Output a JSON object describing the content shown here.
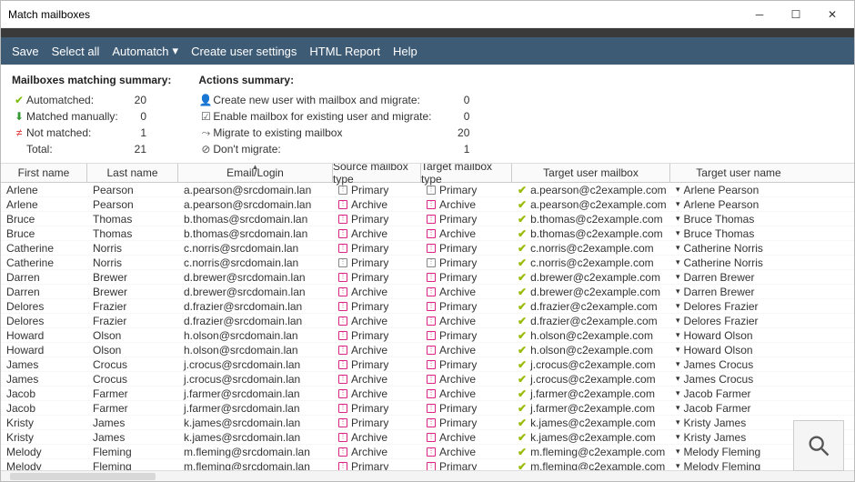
{
  "title": "Match mailboxes",
  "menubar": [
    "Save",
    "Select all",
    "Automatch",
    "Create user settings",
    "HTML Report",
    "Help"
  ],
  "summary": {
    "heading": "Mailboxes matching summary:",
    "rows": [
      {
        "icon": "check-green",
        "label": "Automatched:",
        "value": "20"
      },
      {
        "icon": "arrow-down-green",
        "label": "Matched manually:",
        "value": "0"
      },
      {
        "icon": "not-equal-red",
        "label": "Not matched:",
        "value": "1"
      },
      {
        "icon": "",
        "label": "Total:",
        "value": "21"
      }
    ]
  },
  "actions": {
    "heading": "Actions summary:",
    "rows": [
      {
        "icon": "user-plus",
        "label": "Create new user with mailbox and migrate:",
        "value": "0"
      },
      {
        "icon": "mailbox-check",
        "label": "Enable mailbox for existing user and migrate:",
        "value": "0"
      },
      {
        "icon": "arrow-right",
        "label": "Migrate to existing mailbox",
        "value": "20"
      },
      {
        "icon": "no-entry",
        "label": "Don't migrate:",
        "value": "1"
      }
    ]
  },
  "columns": [
    "First name",
    "Last name",
    "Email/Login",
    "Source mailbox type",
    "Target mailbox type",
    "Target user mailbox",
    "Target user name"
  ],
  "rows": [
    {
      "fn": "Arlene",
      "ln": "Pearson",
      "em": "a.pearson@srcdomain.lan",
      "st": "Primary",
      "stc": "gray",
      "tt": "Primary",
      "ttc": "gray",
      "tm": "a.pearson@c2example.com",
      "tn": "Arlene Pearson"
    },
    {
      "fn": "Arlene",
      "ln": "Pearson",
      "em": "a.pearson@srcdomain.lan",
      "st": "Archive",
      "stc": "pink",
      "tt": "Archive",
      "ttc": "pink",
      "tm": "a.pearson@c2example.com",
      "tn": "Arlene Pearson"
    },
    {
      "fn": "Bruce",
      "ln": "Thomas",
      "em": "b.thomas@srcdomain.lan",
      "st": "Primary",
      "stc": "pink",
      "tt": "Primary",
      "ttc": "pink",
      "tm": "b.thomas@c2example.com",
      "tn": "Bruce Thomas"
    },
    {
      "fn": "Bruce",
      "ln": "Thomas",
      "em": "b.thomas@srcdomain.lan",
      "st": "Archive",
      "stc": "pink",
      "tt": "Archive",
      "ttc": "pink",
      "tm": "b.thomas@c2example.com",
      "tn": "Bruce Thomas"
    },
    {
      "fn": "Catherine",
      "ln": "Norris",
      "em": "c.norris@srcdomain.lan",
      "st": "Primary",
      "stc": "pink",
      "tt": "Primary",
      "ttc": "pink",
      "tm": "c.norris@c2example.com",
      "tn": "Catherine Norris"
    },
    {
      "fn": "Catherine",
      "ln": "Norris",
      "em": "c.norris@srcdomain.lan",
      "st": "Primary",
      "stc": "gray",
      "tt": "Primary",
      "ttc": "gray",
      "tm": "c.norris@c2example.com",
      "tn": "Catherine Norris"
    },
    {
      "fn": "Darren",
      "ln": "Brewer",
      "em": "d.brewer@srcdomain.lan",
      "st": "Primary",
      "stc": "pink",
      "tt": "Primary",
      "ttc": "pink",
      "tm": "d.brewer@c2example.com",
      "tn": "Darren Brewer"
    },
    {
      "fn": "Darren",
      "ln": "Brewer",
      "em": "d.brewer@srcdomain.lan",
      "st": "Archive",
      "stc": "pink",
      "tt": "Archive",
      "ttc": "pink",
      "tm": "d.brewer@c2example.com",
      "tn": "Darren Brewer"
    },
    {
      "fn": "Delores",
      "ln": "Frazier",
      "em": "d.frazier@srcdomain.lan",
      "st": "Primary",
      "stc": "pink",
      "tt": "Primary",
      "ttc": "pink",
      "tm": "d.frazier@c2example.com",
      "tn": "Delores Frazier"
    },
    {
      "fn": "Delores",
      "ln": "Frazier",
      "em": "d.frazier@srcdomain.lan",
      "st": "Archive",
      "stc": "pink",
      "tt": "Archive",
      "ttc": "pink",
      "tm": "d.frazier@c2example.com",
      "tn": "Delores Frazier"
    },
    {
      "fn": "Howard",
      "ln": "Olson",
      "em": "h.olson@srcdomain.lan",
      "st": "Primary",
      "stc": "pink",
      "tt": "Primary",
      "ttc": "pink",
      "tm": "h.olson@c2example.com",
      "tn": "Howard Olson"
    },
    {
      "fn": "Howard",
      "ln": "Olson",
      "em": "h.olson@srcdomain.lan",
      "st": "Archive",
      "stc": "pink",
      "tt": "Archive",
      "ttc": "pink",
      "tm": "h.olson@c2example.com",
      "tn": "Howard Olson"
    },
    {
      "fn": "James",
      "ln": "Crocus",
      "em": "j.crocus@srcdomain.lan",
      "st": "Primary",
      "stc": "pink",
      "tt": "Primary",
      "ttc": "pink",
      "tm": "j.crocus@c2example.com",
      "tn": "James Crocus"
    },
    {
      "fn": "James",
      "ln": "Crocus",
      "em": "j.crocus@srcdomain.lan",
      "st": "Archive",
      "stc": "pink",
      "tt": "Archive",
      "ttc": "pink",
      "tm": "j.crocus@c2example.com",
      "tn": "James Crocus"
    },
    {
      "fn": "Jacob",
      "ln": "Farmer",
      "em": "j.farmer@srcdomain.lan",
      "st": "Archive",
      "stc": "pink",
      "tt": "Archive",
      "ttc": "pink",
      "tm": "j.farmer@c2example.com",
      "tn": "Jacob Farmer"
    },
    {
      "fn": "Jacob",
      "ln": "Farmer",
      "em": "j.farmer@srcdomain.lan",
      "st": "Primary",
      "stc": "pink",
      "tt": "Primary",
      "ttc": "pink",
      "tm": "j.farmer@c2example.com",
      "tn": "Jacob Farmer"
    },
    {
      "fn": "Kristy",
      "ln": "James",
      "em": "k.james@srcdomain.lan",
      "st": "Primary",
      "stc": "pink",
      "tt": "Primary",
      "ttc": "pink",
      "tm": "k.james@c2example.com",
      "tn": "Kristy James"
    },
    {
      "fn": "Kristy",
      "ln": "James",
      "em": "k.james@srcdomain.lan",
      "st": "Archive",
      "stc": "pink",
      "tt": "Archive",
      "ttc": "pink",
      "tm": "k.james@c2example.com",
      "tn": "Kristy James"
    },
    {
      "fn": "Melody",
      "ln": "Fleming",
      "em": "m.fleming@srcdomain.lan",
      "st": "Archive",
      "stc": "pink",
      "tt": "Archive",
      "ttc": "pink",
      "tm": "m.fleming@c2example.com",
      "tn": "Melody Fleming"
    },
    {
      "fn": "Melody",
      "ln": "Fleming",
      "em": "m.fleming@srcdomain.lan",
      "st": "Primary",
      "stc": "pink",
      "tt": "Primary",
      "ttc": "pink",
      "tm": "m.fleming@c2example.com",
      "tn": "Melody Fleming"
    }
  ]
}
